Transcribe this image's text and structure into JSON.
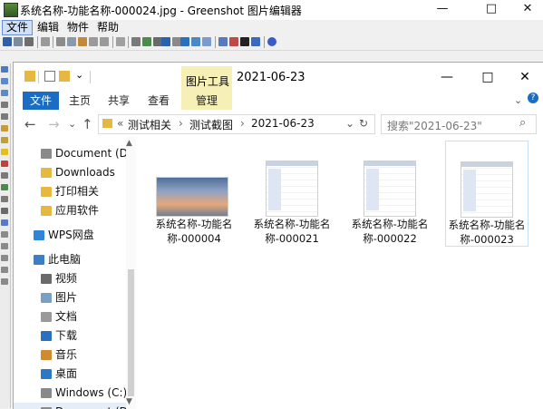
{
  "window": {
    "title": "系统名称-功能名称-000024.jpg - Greenshot 图片编辑器",
    "min_glyph": "—",
    "max_glyph": "□",
    "close_glyph": "✕"
  },
  "menubar": [
    "文件",
    "编辑",
    "物件",
    "帮助"
  ],
  "explorer": {
    "title_date": "2021-06-23",
    "tool_tab": "图片工具",
    "ribbon_tabs": {
      "file": "文件",
      "home": "主页",
      "share": "共享",
      "view": "查看",
      "manage": "管理"
    },
    "nav_glyphs": {
      "back": "←",
      "forward": "→",
      "down": "⌄",
      "up": "↑",
      "refresh": "↻",
      "search": "⌕",
      "chevron": "⌄",
      "help": "?"
    },
    "address": {
      "prefix": "«",
      "parts": [
        "测试相关",
        "测试截图",
        "2021-06-23"
      ],
      "sep": "›"
    },
    "search_placeholder": "搜索\"2021-06-23\"",
    "window_buttons": {
      "min": "—",
      "max": "□",
      "close": "✕"
    }
  },
  "nav_pane": [
    {
      "label": "Document (D:)",
      "icon": "drive-icon"
    },
    {
      "label": "Downloads",
      "icon": "folder-icon"
    },
    {
      "label": "打印相关",
      "icon": "folder-icon"
    },
    {
      "label": "应用软件",
      "icon": "folder-icon"
    },
    {
      "label": "WPS网盘",
      "icon": "cloud-icon"
    },
    {
      "label": "此电脑",
      "icon": "computer-icon"
    },
    {
      "label": "视频",
      "icon": "video-icon"
    },
    {
      "label": "图片",
      "icon": "picture-icon"
    },
    {
      "label": "文档",
      "icon": "document-icon"
    },
    {
      "label": "下载",
      "icon": "download-icon"
    },
    {
      "label": "音乐",
      "icon": "music-icon"
    },
    {
      "label": "桌面",
      "icon": "desktop-icon"
    },
    {
      "label": "Windows (C:)",
      "icon": "drive-icon"
    },
    {
      "label": "Document (D:)",
      "icon": "drive-icon"
    }
  ],
  "files": [
    {
      "line1": "系统名称-功能名",
      "line2": "称-000004",
      "thumb": "sky-photo"
    },
    {
      "line1": "系统名称-功能名",
      "line2": "称-000021",
      "thumb": "screenshot"
    },
    {
      "line1": "系统名称-功能名",
      "line2": "称-000022",
      "thumb": "screenshot"
    },
    {
      "line1": "系统名称-功能名",
      "line2": "称-000023",
      "thumb": "screenshot"
    }
  ],
  "colors": {
    "file_tab": "#1a6dc2",
    "tool_tab": "#f6f0b6",
    "folder": "#e7b83f"
  }
}
